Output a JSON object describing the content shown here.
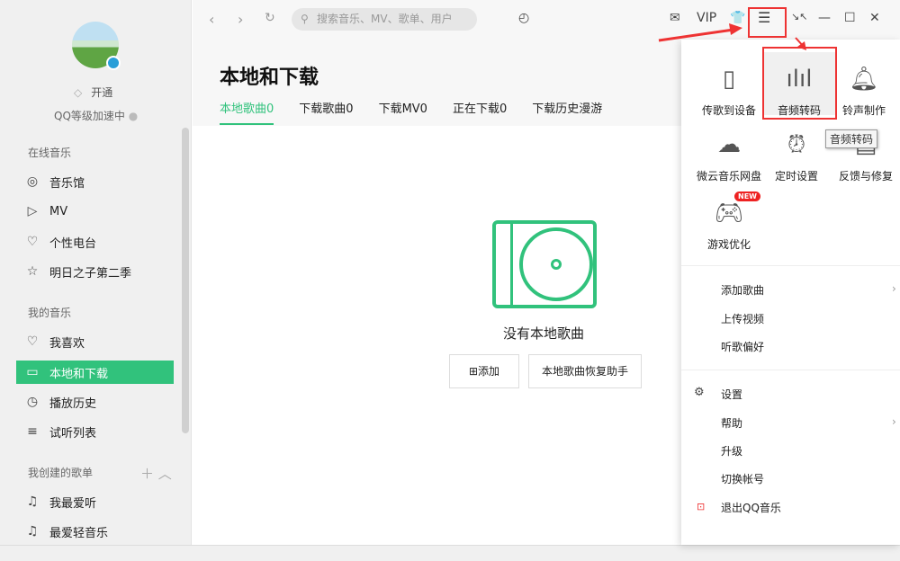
{
  "sidebar": {
    "vip_label": "开通",
    "qq_level": "QQ等级加速中",
    "sections": {
      "online": "在线音乐",
      "mine": "我的音乐",
      "created": "我创建的歌单"
    },
    "online_items": [
      "音乐馆",
      "MV",
      "个性电台",
      "明日之子第二季"
    ],
    "my_items": [
      "我喜欢",
      "本地和下载",
      "播放历史",
      "试听列表"
    ],
    "playlists": [
      "我最爱听",
      "最爱轻音乐"
    ]
  },
  "topbar": {
    "search_placeholder": "搜索音乐、MV、歌单、用户",
    "vip": "VIP"
  },
  "main": {
    "title": "本地和下载",
    "tabs": [
      "本地歌曲0",
      "下载歌曲0",
      "下载MV0",
      "正在下载0",
      "下载历史漫游"
    ],
    "empty_text": "没有本地歌曲",
    "add_button": "添加",
    "restore_button": "本地歌曲恢复助手"
  },
  "menu": {
    "grid": [
      "传歌到设备",
      "音频转码",
      "铃声制作",
      "微云音乐网盘",
      "定时设置",
      "反馈与修复",
      "游戏优化"
    ],
    "new_badge": "NEW",
    "tooltip": "音频转码",
    "items1": [
      "添加歌曲",
      "上传视频",
      "听歌偏好"
    ],
    "items2": [
      "设置",
      "帮助",
      "升级",
      "切换帐号",
      "退出QQ音乐"
    ]
  },
  "colors": {
    "accent": "#31c27c",
    "annotation": "#e33333"
  }
}
